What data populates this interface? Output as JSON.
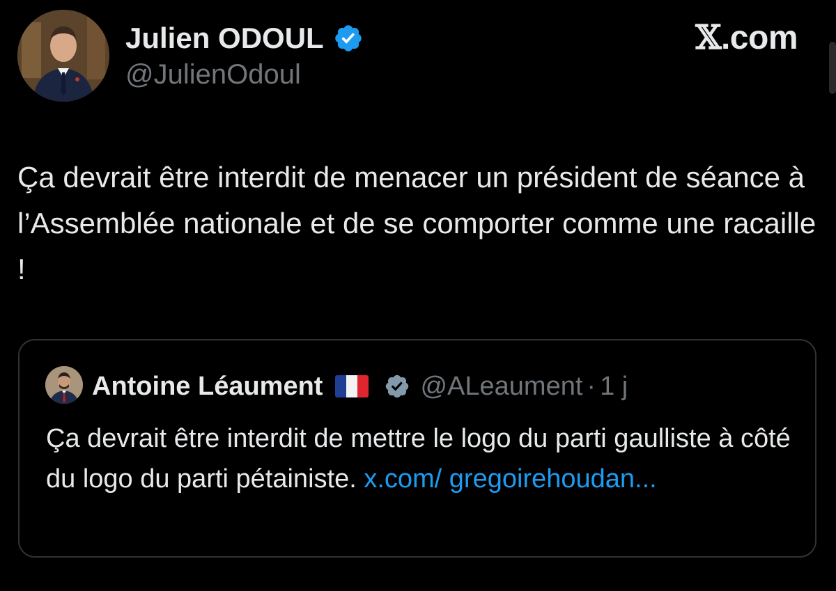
{
  "tweet": {
    "author": {
      "name": "Julien ODOUL",
      "handle": "@JulienOdoul",
      "verified": true,
      "avatar_icon": "profile-photo"
    },
    "site_label": {
      "x": "𝕏",
      "rest": ".com"
    },
    "text": "Ça devrait être interdit de menacer un président de séance à l’Assemblée nationale et de se comporter comme une racaille !"
  },
  "quoted_tweet": {
    "author": {
      "name": "Antoine Léaument",
      "flag_icon": "france-flag",
      "verified_icon": "verified-badge-gray",
      "handle": "@ALeaument",
      "separator": "·",
      "time": "1 j"
    },
    "text": "Ça devrait être interdit de mettre le logo du parti gaulliste à côté du logo du parti pétainiste.",
    "link_text": "x.com/ gregoirehoudan..."
  },
  "colors": {
    "background": "#000000",
    "text_primary": "#e7e9ea",
    "text_secondary": "#71767b",
    "link": "#1d9bf0",
    "verified_blue": "#1d9bf0",
    "verified_gray": "#829aab",
    "card_border": "#2f3336"
  }
}
